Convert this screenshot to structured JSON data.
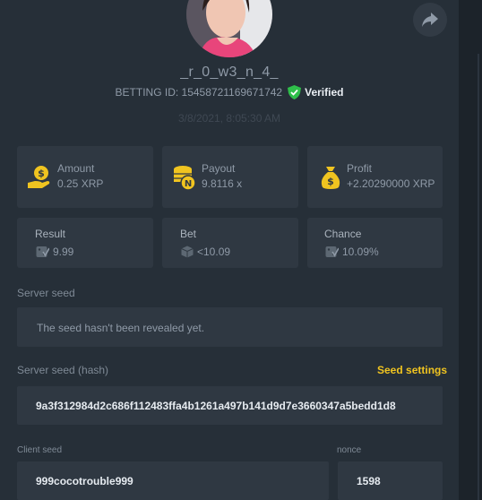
{
  "header": {
    "username": "_r_0_w3_n_4_",
    "betting_id": "BETTING ID: 15458721169671742",
    "verified_label": "Verified",
    "date": "3/8/2021, 8:05:30 AM"
  },
  "stats": {
    "amount": {
      "label": "Amount",
      "value": "0.25 XRP",
      "icon": "money-bag-hand-icon"
    },
    "payout": {
      "label": "Payout",
      "value": "9.8116 x",
      "icon": "coin-stack-icon"
    },
    "profit": {
      "label": "Profit",
      "value": "+2.20290000 XRP",
      "icon": "money-bag-icon"
    },
    "result": {
      "label": "Result",
      "value": "9.99",
      "icon": "dice-icon"
    },
    "bet": {
      "label": "Bet",
      "value": "<10.09",
      "icon": "dice-icon"
    },
    "chance": {
      "label": "Chance",
      "value": "10.09%",
      "icon": "dice-icon"
    }
  },
  "server_seed": {
    "label": "Server seed",
    "value": "The seed hasn't been revealed yet."
  },
  "server_seed_hash": {
    "label": "Server seed (hash)",
    "settings_link": "Seed settings",
    "value": "9a3f312984d2c686f112483ffa4b1261a497b141d9d7e3660347a5bedd1d8"
  },
  "client_seed": {
    "label": "Client seed",
    "value": "999cocotrouble999"
  },
  "nonce": {
    "label": "nonce",
    "value": "1598"
  },
  "colors": {
    "panel": "#262f38",
    "card": "#2f3842",
    "accent_gold": "#f0c420",
    "verified_green": "#2fbf4a"
  }
}
